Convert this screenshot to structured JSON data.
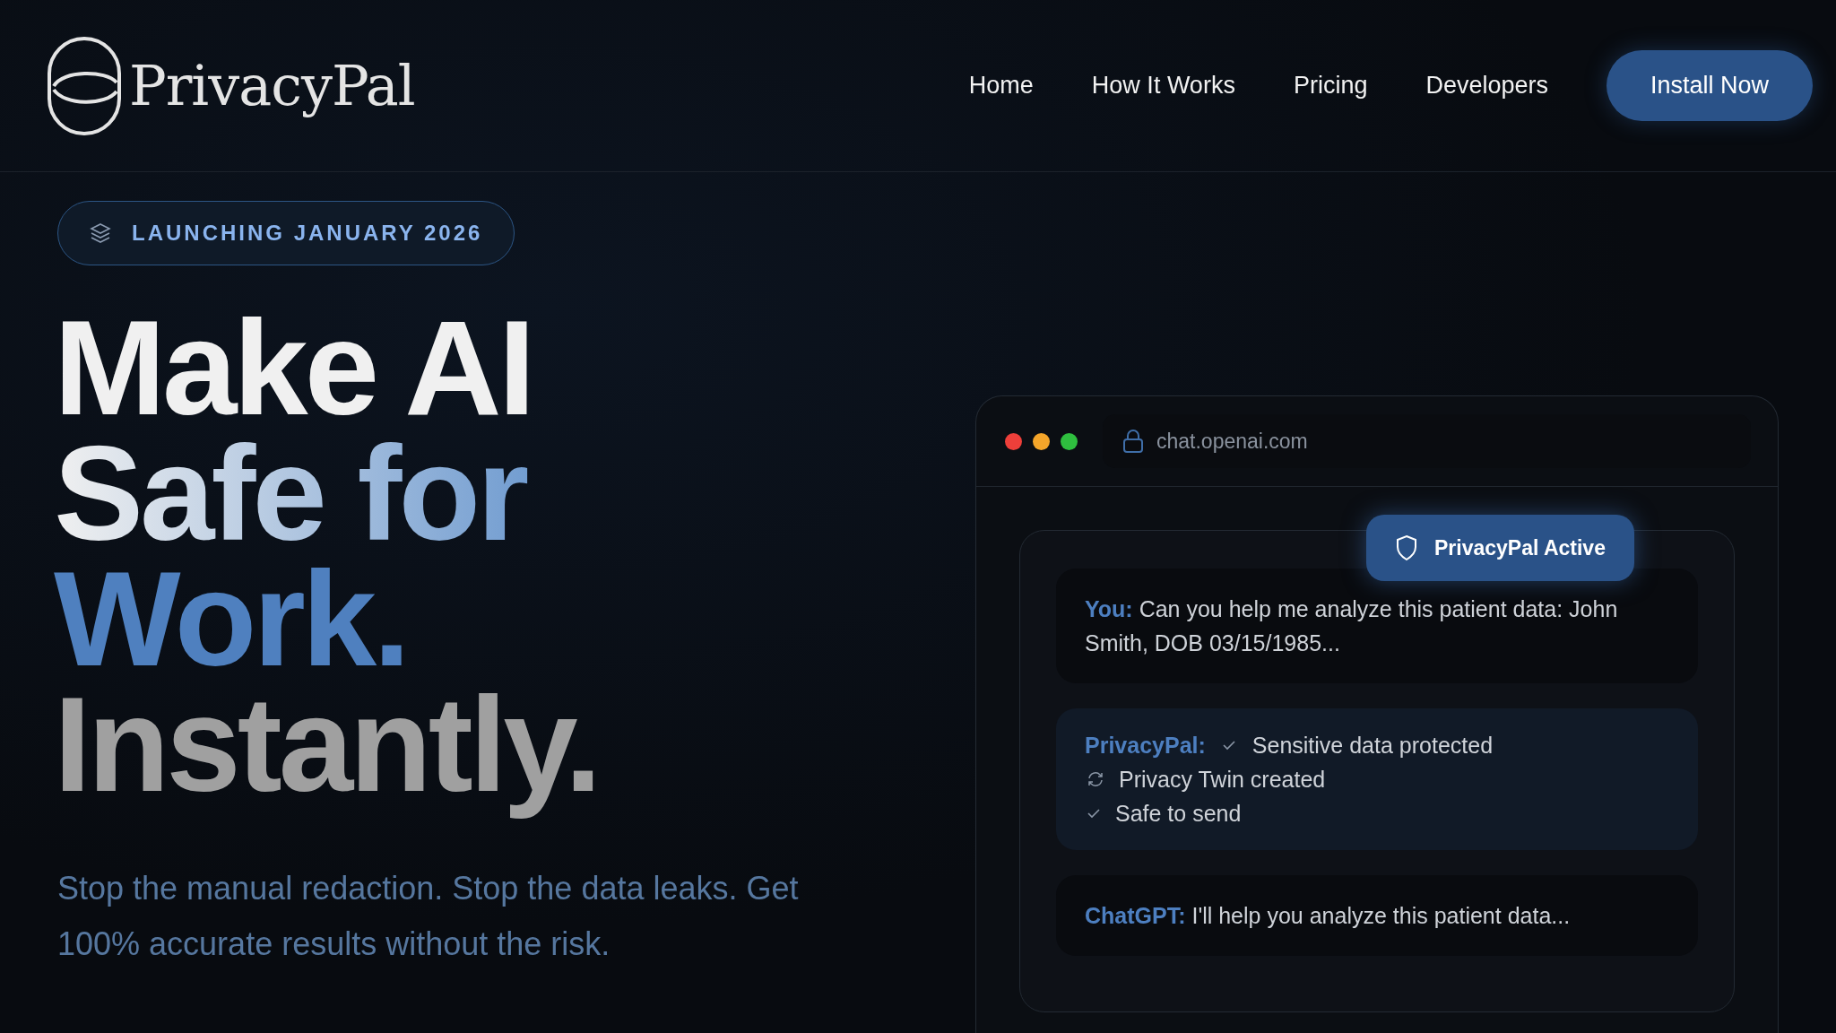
{
  "brand": {
    "name": "PrivacyPal"
  },
  "nav": {
    "links": [
      "Home",
      "How It Works",
      "Pricing",
      "Developers"
    ],
    "cta": "Install Now"
  },
  "hero": {
    "badge": "LAUNCHING JANUARY 2026",
    "headline": [
      "Make AI",
      "Safe for",
      "Work.",
      "Instantly."
    ],
    "subtitle": "Stop the manual redaction. Stop the data leaks. Get 100% accurate results without the risk."
  },
  "browser": {
    "url": "chat.openai.com",
    "status_badge": "PrivacyPal Active",
    "messages": [
      {
        "kind": "user",
        "sender": "You:",
        "text": "Can you help me analyze this patient data: John Smith, DOB 03/15/1985..."
      },
      {
        "kind": "status",
        "sender": "PrivacyPal:",
        "items": [
          {
            "kind": "check",
            "text": "Sensitive data protected"
          },
          {
            "kind": "sync",
            "text": "Privacy Twin created"
          },
          {
            "kind": "check",
            "text": "Safe to send"
          }
        ]
      },
      {
        "kind": "reply",
        "sender": "ChatGPT:",
        "text": "I'll help you analyze this patient data..."
      }
    ]
  }
}
